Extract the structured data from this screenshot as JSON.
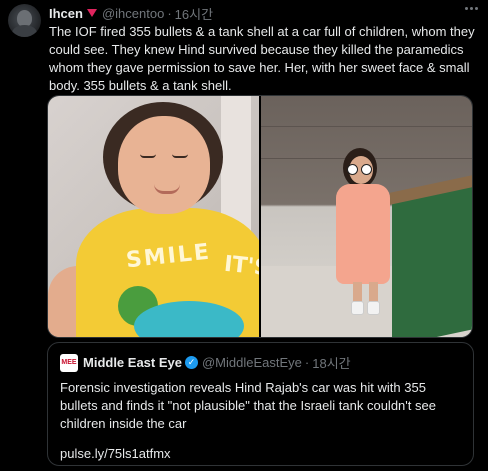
{
  "tweet": {
    "display_name": "Ihcen",
    "handle": "@ihcentoo",
    "separator": "·",
    "time": "16시간",
    "text": "The IOF fired 355 bullets & a tank shell at a car full of children, whom they could see. They knew Hind survived because they killed the paramedics whom they gave permission to save her. Her, with her sweet face & small body. 355 bullets & a tank shell.",
    "flag_color": "#e0245e",
    "avatar_icon": "profile-avatar",
    "more_icon": "more-dots-icon"
  },
  "media": {
    "left_photo": {
      "shirt_text_1": "SMILE",
      "shirt_text_2": "IT'S"
    },
    "right_photo": {}
  },
  "quote": {
    "logo_text": "MEE",
    "display_name": "Middle East Eye",
    "verified_icon": "verified-badge-icon",
    "verified_glyph": "✓",
    "handle": "@MiddleEastEye",
    "separator": "·",
    "time": "18시간",
    "text": "Forensic investigation reveals Hind Rajab's car was hit with 355 bullets and finds it \"not plausible\" that the Israeli tank couldn't see children inside the car",
    "link": "pulse.ly/75ls1atfmx",
    "accent_color": "#1d9bf0"
  }
}
